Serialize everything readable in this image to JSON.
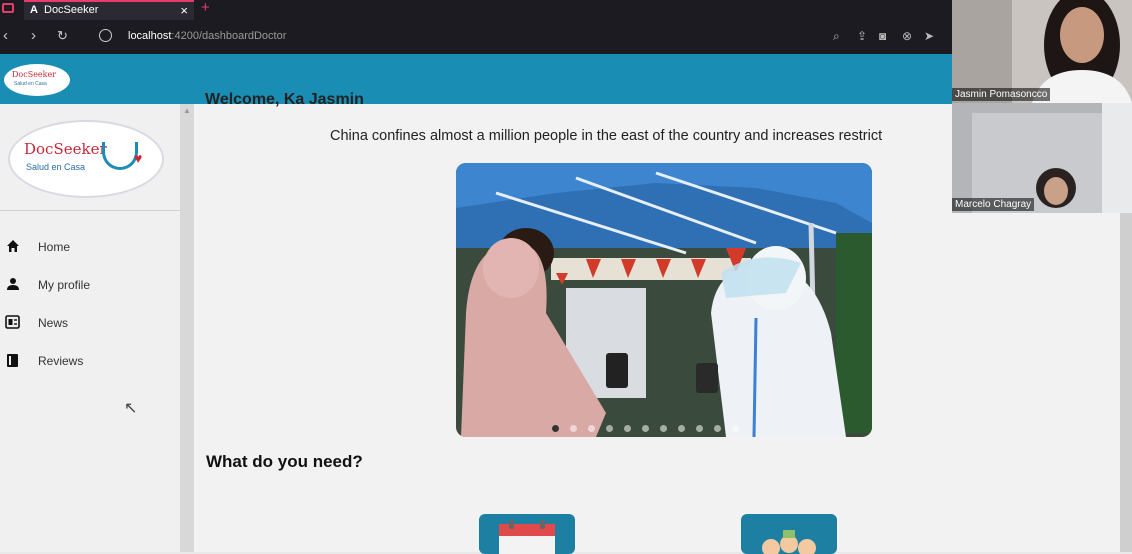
{
  "browser": {
    "tab_title": "DocSeeker",
    "tab_icon": "A",
    "close_glyph": "×",
    "new_tab_glyph": "+",
    "url_host": "localhost",
    "url_path": ":4200/dashboardDoctor"
  },
  "sidebar": {
    "logo_title": "DocSeeker",
    "logo_subtitle": "Salud en Casa",
    "items": [
      {
        "label": "Home",
        "icon": "home-icon"
      },
      {
        "label": "My profile",
        "icon": "person-icon"
      },
      {
        "label": "News",
        "icon": "news-icon"
      },
      {
        "label": "Reviews",
        "icon": "book-icon"
      }
    ]
  },
  "main": {
    "welcome": "Welcome, Ka Jasmin",
    "headline": "China confines almost a million people in the east of the country and increases restrict",
    "carousel": {
      "active_index": 0
    },
    "section_title": "What do you need?"
  },
  "video_call": {
    "participants": [
      {
        "name": "Jasmin Pomasoncco"
      },
      {
        "name": "Marcelo Chagray"
      }
    ]
  },
  "colors": {
    "header": "#1a8db4",
    "accent": "#e83b6e"
  }
}
